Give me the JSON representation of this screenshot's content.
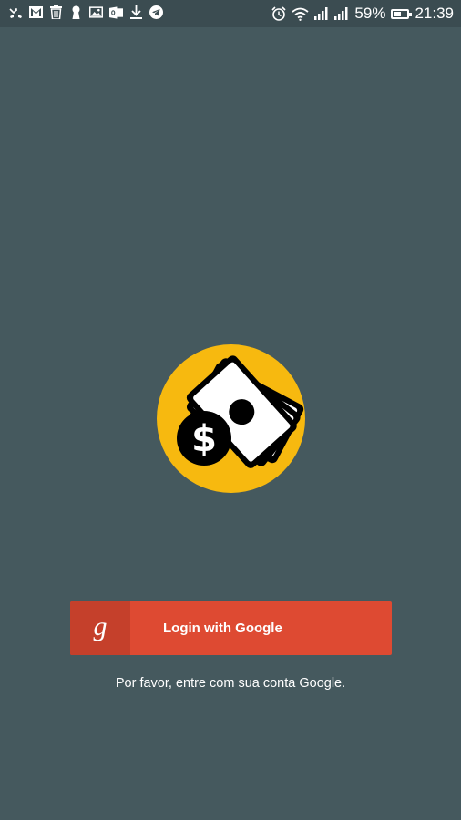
{
  "status_bar": {
    "battery_percent": "59%",
    "battery_level": 0.59,
    "time": "21:39",
    "left_icons": [
      "missed-call-icon",
      "gmail-icon",
      "trash-icon",
      "keyhole-icon",
      "image-icon",
      "outlook-icon",
      "download-icon",
      "telegram-icon"
    ],
    "right_icons": [
      "alarm-icon",
      "wifi-icon",
      "signal-1-icon",
      "signal-2-icon",
      "battery-icon"
    ]
  },
  "logo": {
    "icon": "money-dollar-icon",
    "circle_color": "#f7b90f",
    "symbol": "$"
  },
  "login": {
    "button_label": "Login with Google",
    "google_glyph": "g",
    "button_color": "#de4a32",
    "icon_box_color": "#c5402b"
  },
  "hint_text": "Por favor, entre com sua conta Google.",
  "colors": {
    "background": "#45595e",
    "status_bar": "#3b4c51"
  }
}
